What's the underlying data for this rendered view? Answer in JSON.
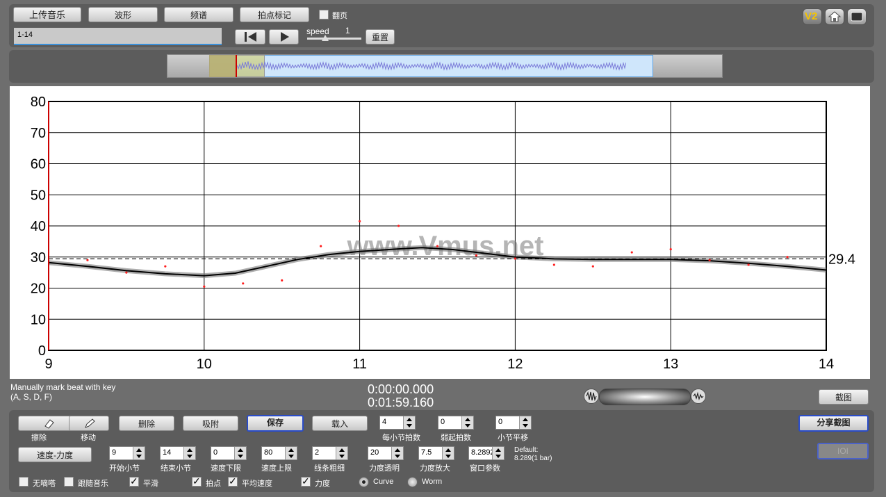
{
  "toolbar": {
    "upload_label": "上传音乐",
    "waveform_label": "波形",
    "spectrum_label": "频谱",
    "beat_label": "拍点标记",
    "flip_label": "翻页",
    "file_value": "1-14",
    "speed_label": "speed",
    "speed_value": "1",
    "reset_label": "重置",
    "v2_label": "V2"
  },
  "chart_data": {
    "type": "line",
    "xlim": [
      9,
      14
    ],
    "ylim": [
      0,
      80
    ],
    "x_ticks": [
      "9",
      "10",
      "11",
      "12",
      "13",
      "14"
    ],
    "y_ticks": [
      "0",
      "10",
      "20",
      "30",
      "40",
      "50",
      "60",
      "70",
      "80"
    ],
    "average_value": 29.4,
    "average_label": "29.4",
    "watermark": "www.Vmus.net",
    "curve": [
      [
        9.0,
        28.2
      ],
      [
        9.25,
        27.0
      ],
      [
        9.5,
        25.6
      ],
      [
        9.75,
        24.6
      ],
      [
        10.0,
        24.0
      ],
      [
        10.2,
        24.8
      ],
      [
        10.4,
        27.0
      ],
      [
        10.6,
        29.2
      ],
      [
        10.8,
        30.8
      ],
      [
        11.0,
        31.8
      ],
      [
        11.25,
        32.6
      ],
      [
        11.4,
        33.0
      ],
      [
        11.6,
        32.4
      ],
      [
        11.8,
        31.2
      ],
      [
        12.0,
        30.0
      ],
      [
        12.25,
        29.4
      ],
      [
        12.5,
        29.2
      ],
      [
        12.75,
        29.2
      ],
      [
        13.0,
        29.2
      ],
      [
        13.25,
        28.8
      ],
      [
        13.5,
        28.0
      ],
      [
        13.75,
        27.0
      ],
      [
        14.0,
        25.8
      ]
    ],
    "points": [
      [
        9.25,
        29.0
      ],
      [
        9.5,
        25.0
      ],
      [
        9.75,
        27.0
      ],
      [
        10.0,
        20.5
      ],
      [
        10.25,
        21.5
      ],
      [
        10.5,
        22.5
      ],
      [
        10.75,
        33.5
      ],
      [
        11.0,
        41.5
      ],
      [
        11.25,
        40.0
      ],
      [
        11.5,
        33.5
      ],
      [
        11.75,
        30.5
      ],
      [
        12.0,
        29.5
      ],
      [
        12.25,
        27.5
      ],
      [
        12.5,
        27.0
      ],
      [
        12.75,
        31.5
      ],
      [
        13.0,
        32.5
      ],
      [
        13.25,
        29.0
      ],
      [
        13.5,
        27.5
      ],
      [
        13.75,
        30.0
      ]
    ],
    "colors": {
      "curve": "#000000",
      "points": "#ff2020",
      "average": "#000000",
      "cursor": "#cc0000"
    }
  },
  "status": {
    "hint_line1": "Manually mark beat with key",
    "hint_line2": "(A, S, D, F)",
    "time_current": "0:00:00.000",
    "time_total": "0:01:59.160",
    "screenshot_label": "截图"
  },
  "controls": {
    "erase_label": "擦除",
    "move_label": "移动",
    "delete_label": "删除",
    "snap_label": "吸附",
    "save_label": "保存",
    "load_label": "载入",
    "beats_per_bar": {
      "value": "4",
      "label": "每小节拍数"
    },
    "pickup_beats": {
      "value": "0",
      "label": "弱起拍数"
    },
    "bar_shift": {
      "value": "0",
      "label": "小节平移"
    },
    "share_label": "分享截图",
    "ioi_label": "IOI",
    "mode_label": "速度-力度",
    "start_bar": {
      "value": "9",
      "label": "开始小节"
    },
    "end_bar": {
      "value": "14",
      "label": "结束小节"
    },
    "tempo_min": {
      "value": "0",
      "label": "速度下限"
    },
    "tempo_max": {
      "value": "80",
      "label": "速度上限"
    },
    "line_width": {
      "value": "2",
      "label": "线条粗细"
    },
    "dyn_alpha": {
      "value": "20",
      "label": "力度透明"
    },
    "dyn_scale": {
      "value": "7.5",
      "label": "力度放大"
    },
    "window_param": {
      "value": "8.2892",
      "label": "窗口参数"
    },
    "default_line1": "Default:",
    "default_line2": "8.289(1 bar)",
    "no_beep_label": "无嘀嗒",
    "follow_music_label": "跟随音乐",
    "smooth_label": "平滑",
    "beat_pts_label": "拍点",
    "avg_tempo_label": "平均速度",
    "dynamics_label": "力度",
    "curve_label": "Curve",
    "worm_label": "Worm"
  }
}
